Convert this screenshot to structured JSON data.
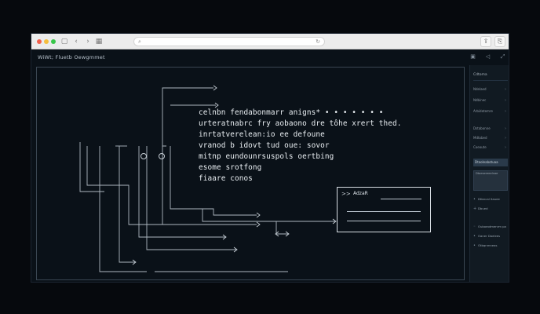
{
  "browser": {
    "traffic_lights": [
      "#f2604c",
      "#f5be3d",
      "#39c74a"
    ],
    "nav_icons": [
      "back-icon",
      "forward-icon",
      "reload-icon",
      "sidebar-toggle-icon"
    ],
    "address_text": "",
    "right_icons": [
      "share-icon",
      "extensions-icon"
    ]
  },
  "app": {
    "title": "WiWt; Fluetb Oewgmmet",
    "top_icons": [
      "window-icon",
      "send-icon",
      "expand-icon"
    ]
  },
  "diagram": {
    "code_lines": [
      "celnbn fendabonmarr anigns* • • • • • • •",
      "urteratnabrc fry aobaono dre tôhe xrert thed.",
      "inrtatverelean:io ee defoune",
      "vranod b idovt tud oue: sovor",
      "mitnp eundounrsuspols oertbing",
      "esome srotfong",
      "fiaare conos"
    ]
  },
  "card": {
    "icon": ">>",
    "label": "AdzaR"
  },
  "sidebar": {
    "header": "Cdtoma",
    "items": [
      {
        "label": "Ndelaed",
        "chev": "›"
      },
      {
        "label": "Ndbinec",
        "chev": "›"
      },
      {
        "label": "Arbidetemre",
        "chev": "›"
      },
      {
        "label": "Dstabonne",
        "chev": "›"
      },
      {
        "label": "Mdtobed",
        "chev": "›"
      },
      {
        "label": "Coeoute",
        "chev": "›"
      }
    ],
    "select_label": "Dtaoleabotuaa",
    "panel_label": "Dtaesereeelnae",
    "rows": [
      {
        "icon": "•",
        "label": "Dtbncal ltauee"
      },
      {
        "icon": "+",
        "label": "Dbued"
      },
      {
        "icon": "◦",
        "label": "Ouboeotmenrm pa"
      },
      {
        "icon": "•",
        "label": "Oaner Daelees"
      },
      {
        "icon": "•",
        "label": "Otbqnmneas"
      }
    ]
  }
}
